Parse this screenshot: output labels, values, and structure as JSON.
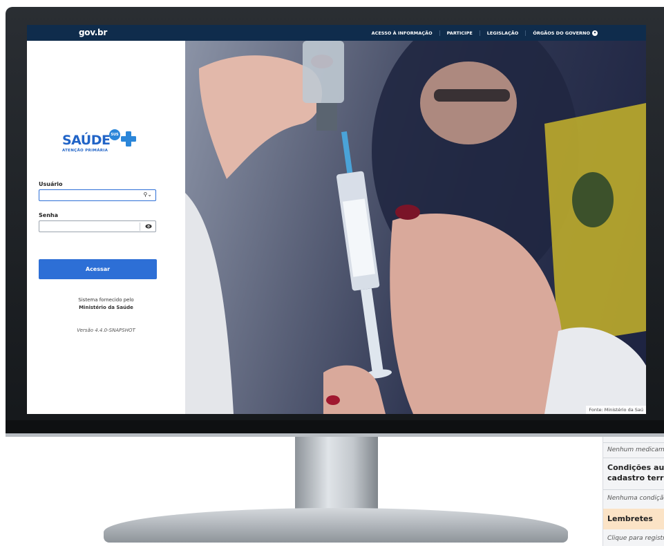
{
  "govbar": {
    "logo": "gov.br",
    "links": [
      "ACESSO À INFORMAÇÃO",
      "PARTICIPE",
      "LEGISLAÇÃO",
      "ÓRGÃOS DO GOVERNO"
    ]
  },
  "brand": {
    "title": "SAÚDE",
    "subtitle": "ATENÇÃO PRIMÁRIA",
    "badge": "SUS"
  },
  "login": {
    "user_label": "Usuário",
    "user_value": "",
    "password_label": "Senha",
    "password_value": "",
    "submit_label": "Acessar"
  },
  "footer": {
    "provided_by": "Sistema fornecido pelo",
    "ministry": "Ministério da Saúde",
    "version": "Versão 4.4.0-SNAPSHOT"
  },
  "photo": {
    "caption": "Fonte: Ministério da Saú"
  },
  "background_page": {
    "row1": "Nenhum medicame",
    "heading_line1": "Condições aut",
    "heading_line2": "cadastro territ",
    "row2": "Nenhuma condição",
    "reminders": "Lembretes",
    "row3": "Clique para registra"
  },
  "colors": {
    "govbar": "#0f2c4c",
    "primary": "#2d6fd6",
    "brand": "#2164c7"
  }
}
